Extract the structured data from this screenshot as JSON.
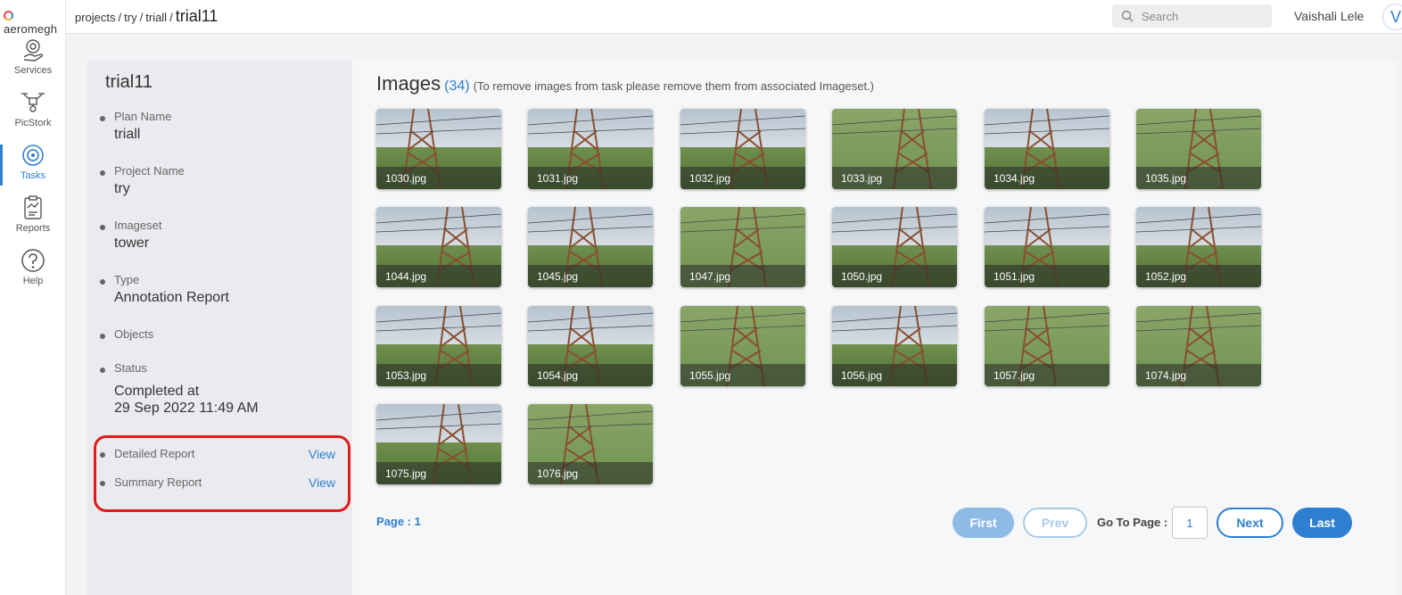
{
  "app": {
    "logo_text": "aeromegh"
  },
  "nav": {
    "items": [
      {
        "label": "Services",
        "icon": "services-icon"
      },
      {
        "label": "PicStork",
        "icon": "drone-icon"
      },
      {
        "label": "Tasks",
        "icon": "tasks-icon",
        "active": true
      },
      {
        "label": "Reports",
        "icon": "reports-icon"
      },
      {
        "label": "Help",
        "icon": "help-icon"
      }
    ]
  },
  "topbar": {
    "breadcrumb": [
      "projects",
      "try",
      "triall"
    ],
    "separator": "/",
    "current": "trial11",
    "search_placeholder": "Search",
    "user_name": "Vaishali Lele",
    "avatar_initial": "V"
  },
  "task": {
    "title": "trial11",
    "fields": [
      {
        "key": "Plan Name",
        "value": "triall"
      },
      {
        "key": "Project Name",
        "value": "try"
      },
      {
        "key": "Imageset",
        "value": "tower"
      },
      {
        "key": "Type",
        "value": "Annotation Report"
      },
      {
        "key": "Objects",
        "value": ""
      }
    ],
    "status": {
      "key": "Status",
      "line1": "Completed at",
      "line2": "29 Sep 2022 11:49 AM"
    },
    "reports": [
      {
        "label": "Detailed Report",
        "action": "View"
      },
      {
        "label": "Summary Report",
        "action": "View"
      }
    ]
  },
  "images": {
    "heading": "Images",
    "count": "(34)",
    "note": "(To remove images from task please remove them from associated Imageset.)",
    "items": [
      {
        "name": "1030.jpg"
      },
      {
        "name": "1031.jpg"
      },
      {
        "name": "1032.jpg"
      },
      {
        "name": "1033.jpg",
        "grass": true
      },
      {
        "name": "1034.jpg"
      },
      {
        "name": "1035.jpg",
        "grass": true
      },
      {
        "name": "1044.jpg"
      },
      {
        "name": "1045.jpg"
      },
      {
        "name": "1047.jpg",
        "grass": true
      },
      {
        "name": "1050.jpg"
      },
      {
        "name": "1051.jpg"
      },
      {
        "name": "1052.jpg"
      },
      {
        "name": "1053.jpg"
      },
      {
        "name": "1054.jpg"
      },
      {
        "name": "1055.jpg",
        "grass": true
      },
      {
        "name": "1056.jpg"
      },
      {
        "name": "1057.jpg",
        "grass": true
      },
      {
        "name": "1074.jpg",
        "grass": true
      },
      {
        "name": "1075.jpg"
      },
      {
        "name": "1076.jpg",
        "grass": true
      }
    ]
  },
  "pagination": {
    "page_label": "Page : 1",
    "first": "First",
    "prev": "Prev",
    "goto_label": "Go To Page :",
    "goto_value": "1",
    "next": "Next",
    "last": "Last"
  },
  "colors": {
    "accent": "#2f7fd0",
    "highlight": "#e01b1b"
  }
}
